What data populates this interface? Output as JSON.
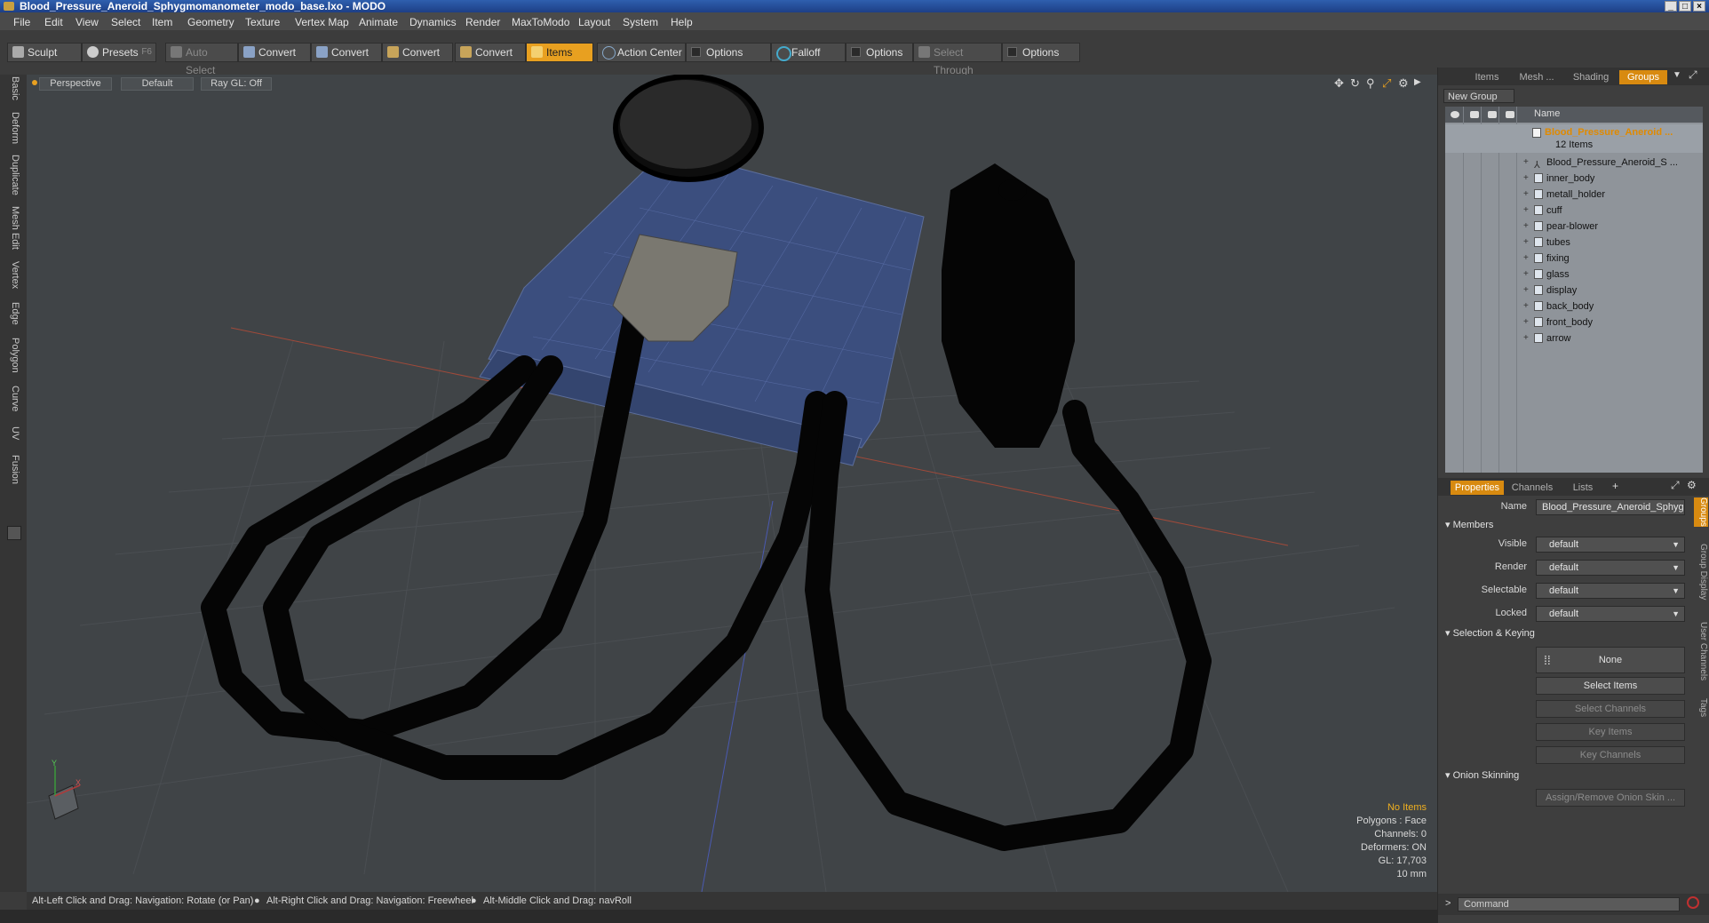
{
  "window": {
    "title": "Blood_Pressure_Aneroid_Sphygmomanometer_modo_base.lxo - MODO"
  },
  "menu": [
    "File",
    "Edit",
    "View",
    "Select",
    "Item",
    "Geometry",
    "Texture",
    "Vertex Map",
    "Animate",
    "Dynamics",
    "Render",
    "MaxToModo",
    "Layout",
    "System",
    "Help"
  ],
  "toolbar": {
    "sculpt": "Sculpt",
    "presets": "Presets",
    "presets_key": "F6",
    "auto_select": "Auto Select",
    "convert1": "Convert",
    "convert2": "Convert",
    "convert3": "Convert",
    "convert4": "Convert",
    "items": "Items",
    "action_center": "Action Center",
    "options1": "Options",
    "falloff": "Falloff",
    "options2": "Options",
    "select_through": "Select Through",
    "options3": "Options"
  },
  "left_tabs": [
    "Basic",
    "Deform",
    "Duplicate",
    "Mesh Edit",
    "Vertex",
    "Edge",
    "Polygon",
    "Curve",
    "UV",
    "Fusion"
  ],
  "viewport": {
    "view": "Perspective",
    "shading": "Default",
    "raygl": "Ray GL: Off",
    "stats": {
      "selection": "No Items",
      "polygons": "Polygons : Face",
      "channels": "Channels: 0",
      "deformers": "Deformers: ON",
      "gl": "GL: 17,703",
      "scale": "10 mm"
    },
    "axis_x": "X",
    "axis_y": "Y"
  },
  "status": {
    "hint1": "Alt-Left Click and Drag: Navigation: Rotate (or Pan)",
    "hint2": "Alt-Right Click and Drag: Navigation: Freewheel",
    "hint3": "Alt-Middle Click and Drag: navRoll"
  },
  "right_panel": {
    "top_tabs": [
      "Items",
      "Mesh ...",
      "Shading",
      "Groups"
    ],
    "new_group": "New Group",
    "name_col": "Name",
    "group": {
      "name": "Blood_Pressure_Aneroid ...",
      "count": "12 Items"
    },
    "items": [
      "Blood_Pressure_Aneroid_S ...",
      "inner_body",
      "metall_holder",
      "cuff",
      "pear-blower",
      "tubes",
      "fixing",
      "glass",
      "display",
      "back_body",
      "front_body",
      "arrow"
    ],
    "prop_tabs": [
      "Properties",
      "Channels",
      "Lists"
    ],
    "props": {
      "name_label": "Name",
      "name_value": "Blood_Pressure_Aneroid_Sphygr",
      "members": "Members",
      "visible_label": "Visible",
      "render_label": "Render",
      "selectable_label": "Selectable",
      "locked_label": "Locked",
      "default": "default",
      "sel_keying": "Selection & Keying",
      "none": "None",
      "select_items": "Select Items",
      "select_channels": "Select Channels",
      "key_items": "Key Items",
      "key_channels": "Key Channels",
      "onion": "Onion Skinning",
      "assign_onion": "Assign/Remove Onion Skin ..."
    },
    "side_tabs": [
      "Groups",
      "Group Display",
      "User Channels",
      "Tags"
    ],
    "command_placeholder": "Command"
  }
}
